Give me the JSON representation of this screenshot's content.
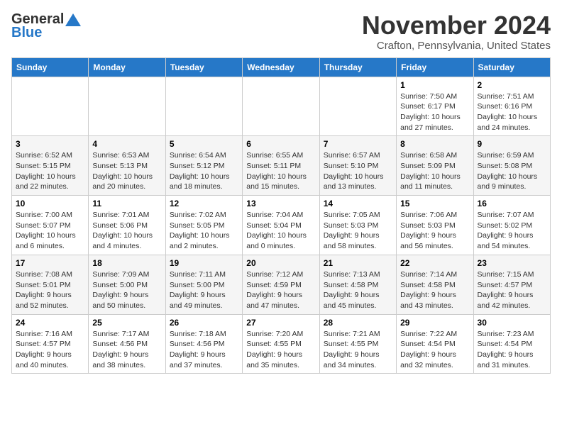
{
  "logo": {
    "line1": "General",
    "line2": "Blue"
  },
  "title": "November 2024",
  "location": "Crafton, Pennsylvania, United States",
  "days_of_week": [
    "Sunday",
    "Monday",
    "Tuesday",
    "Wednesday",
    "Thursday",
    "Friday",
    "Saturday"
  ],
  "weeks": [
    [
      {
        "day": "",
        "info": ""
      },
      {
        "day": "",
        "info": ""
      },
      {
        "day": "",
        "info": ""
      },
      {
        "day": "",
        "info": ""
      },
      {
        "day": "",
        "info": ""
      },
      {
        "day": "1",
        "info": "Sunrise: 7:50 AM\nSunset: 6:17 PM\nDaylight: 10 hours and 27 minutes."
      },
      {
        "day": "2",
        "info": "Sunrise: 7:51 AM\nSunset: 6:16 PM\nDaylight: 10 hours and 24 minutes."
      }
    ],
    [
      {
        "day": "3",
        "info": "Sunrise: 6:52 AM\nSunset: 5:15 PM\nDaylight: 10 hours and 22 minutes."
      },
      {
        "day": "4",
        "info": "Sunrise: 6:53 AM\nSunset: 5:13 PM\nDaylight: 10 hours and 20 minutes."
      },
      {
        "day": "5",
        "info": "Sunrise: 6:54 AM\nSunset: 5:12 PM\nDaylight: 10 hours and 18 minutes."
      },
      {
        "day": "6",
        "info": "Sunrise: 6:55 AM\nSunset: 5:11 PM\nDaylight: 10 hours and 15 minutes."
      },
      {
        "day": "7",
        "info": "Sunrise: 6:57 AM\nSunset: 5:10 PM\nDaylight: 10 hours and 13 minutes."
      },
      {
        "day": "8",
        "info": "Sunrise: 6:58 AM\nSunset: 5:09 PM\nDaylight: 10 hours and 11 minutes."
      },
      {
        "day": "9",
        "info": "Sunrise: 6:59 AM\nSunset: 5:08 PM\nDaylight: 10 hours and 9 minutes."
      }
    ],
    [
      {
        "day": "10",
        "info": "Sunrise: 7:00 AM\nSunset: 5:07 PM\nDaylight: 10 hours and 6 minutes."
      },
      {
        "day": "11",
        "info": "Sunrise: 7:01 AM\nSunset: 5:06 PM\nDaylight: 10 hours and 4 minutes."
      },
      {
        "day": "12",
        "info": "Sunrise: 7:02 AM\nSunset: 5:05 PM\nDaylight: 10 hours and 2 minutes."
      },
      {
        "day": "13",
        "info": "Sunrise: 7:04 AM\nSunset: 5:04 PM\nDaylight: 10 hours and 0 minutes."
      },
      {
        "day": "14",
        "info": "Sunrise: 7:05 AM\nSunset: 5:03 PM\nDaylight: 9 hours and 58 minutes."
      },
      {
        "day": "15",
        "info": "Sunrise: 7:06 AM\nSunset: 5:03 PM\nDaylight: 9 hours and 56 minutes."
      },
      {
        "day": "16",
        "info": "Sunrise: 7:07 AM\nSunset: 5:02 PM\nDaylight: 9 hours and 54 minutes."
      }
    ],
    [
      {
        "day": "17",
        "info": "Sunrise: 7:08 AM\nSunset: 5:01 PM\nDaylight: 9 hours and 52 minutes."
      },
      {
        "day": "18",
        "info": "Sunrise: 7:09 AM\nSunset: 5:00 PM\nDaylight: 9 hours and 50 minutes."
      },
      {
        "day": "19",
        "info": "Sunrise: 7:11 AM\nSunset: 5:00 PM\nDaylight: 9 hours and 49 minutes."
      },
      {
        "day": "20",
        "info": "Sunrise: 7:12 AM\nSunset: 4:59 PM\nDaylight: 9 hours and 47 minutes."
      },
      {
        "day": "21",
        "info": "Sunrise: 7:13 AM\nSunset: 4:58 PM\nDaylight: 9 hours and 45 minutes."
      },
      {
        "day": "22",
        "info": "Sunrise: 7:14 AM\nSunset: 4:58 PM\nDaylight: 9 hours and 43 minutes."
      },
      {
        "day": "23",
        "info": "Sunrise: 7:15 AM\nSunset: 4:57 PM\nDaylight: 9 hours and 42 minutes."
      }
    ],
    [
      {
        "day": "24",
        "info": "Sunrise: 7:16 AM\nSunset: 4:57 PM\nDaylight: 9 hours and 40 minutes."
      },
      {
        "day": "25",
        "info": "Sunrise: 7:17 AM\nSunset: 4:56 PM\nDaylight: 9 hours and 38 minutes."
      },
      {
        "day": "26",
        "info": "Sunrise: 7:18 AM\nSunset: 4:56 PM\nDaylight: 9 hours and 37 minutes."
      },
      {
        "day": "27",
        "info": "Sunrise: 7:20 AM\nSunset: 4:55 PM\nDaylight: 9 hours and 35 minutes."
      },
      {
        "day": "28",
        "info": "Sunrise: 7:21 AM\nSunset: 4:55 PM\nDaylight: 9 hours and 34 minutes."
      },
      {
        "day": "29",
        "info": "Sunrise: 7:22 AM\nSunset: 4:54 PM\nDaylight: 9 hours and 32 minutes."
      },
      {
        "day": "30",
        "info": "Sunrise: 7:23 AM\nSunset: 4:54 PM\nDaylight: 9 hours and 31 minutes."
      }
    ]
  ]
}
